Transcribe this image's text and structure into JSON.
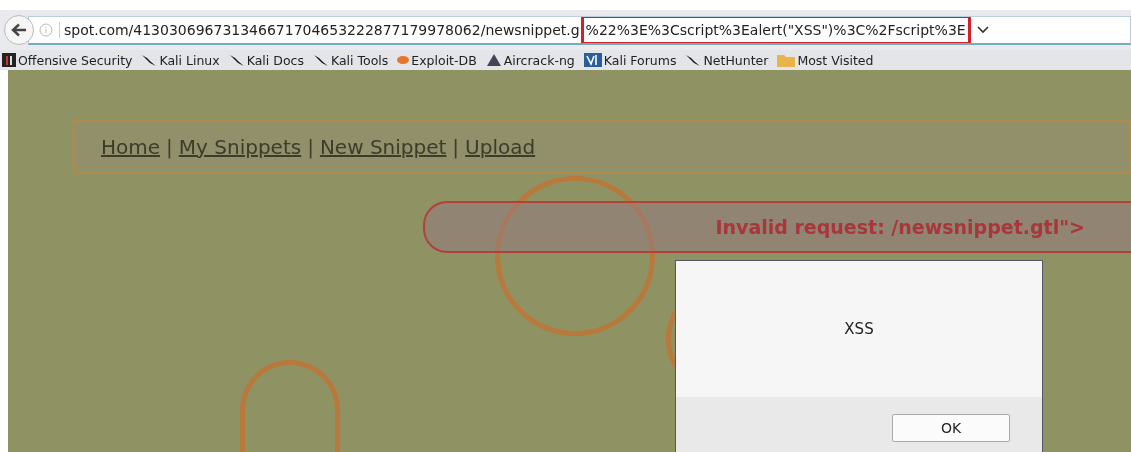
{
  "browser": {
    "url": "spot.com/413030696731346671704653222877179978062/newsnippet.g",
    "url_highlighted": "%22%3E%3Cscript%3Ealert(\"XSS\")%3C%2Fscript%3E"
  },
  "bookmarks": [
    {
      "label": "Offensive Security",
      "kind": "offsec"
    },
    {
      "label": "Kali Linux",
      "kind": "kali"
    },
    {
      "label": "Kali Docs",
      "kind": "kali"
    },
    {
      "label": "Kali Tools",
      "kind": "kali"
    },
    {
      "label": "Exploit-DB",
      "kind": "exploit"
    },
    {
      "label": "Aircrack-ng",
      "kind": "aircrack"
    },
    {
      "label": "Kali Forums",
      "kind": "forums"
    },
    {
      "label": "NetHunter",
      "kind": "kali"
    },
    {
      "label": "Most Visited",
      "kind": "folder"
    }
  ],
  "nav": [
    {
      "label": "Home"
    },
    {
      "label": "My Snippets"
    },
    {
      "label": "New Snippet"
    },
    {
      "label": "Upload"
    }
  ],
  "nav_separator": "|",
  "error": "Invalid request: /newsnippet.gtl\">",
  "dialog": {
    "message": "XSS",
    "button": "OK"
  }
}
